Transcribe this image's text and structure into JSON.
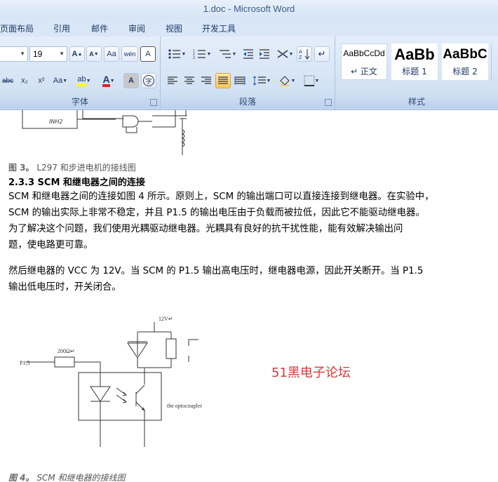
{
  "window": {
    "title": "1.doc - Microsoft Word"
  },
  "tabs": [
    "页面布局",
    "引用",
    "邮件",
    "审阅",
    "视图",
    "开发工具"
  ],
  "font_group": {
    "label": "字体",
    "font_size": "19",
    "buttons": {
      "grow": "A",
      "shrink": "A",
      "clear": "Aa",
      "phonetic": "wén",
      "border": "A",
      "strike": "abc",
      "subscript": "x₂",
      "superscript": "x²",
      "case": "Aa",
      "highlight": "ab",
      "color": "A",
      "shade": "A",
      "enclose": "字"
    }
  },
  "paragraph_group": {
    "label": "段落"
  },
  "styles_group": {
    "label": "样式",
    "styles": [
      {
        "sample": "AaBbCcDd",
        "name": "↵ 正文"
      },
      {
        "sample": "AaBb",
        "name": "标题 1"
      },
      {
        "sample": "AaBbC",
        "name": "标题 2"
      }
    ]
  },
  "document": {
    "fig3_label": "图 3。",
    "fig3_caption": "L297 和步进电机的接线图",
    "diagram3_label": "INH2",
    "heading": "2.3.3 SCM 和继电器之间的连接",
    "para1_lines": [
      "SCM 和继电器之间的连接如图 4 所示。原则上，SCM 的输出端口可以直接连接到继电器。在实验中，",
      "SCM 的输出实际上非常不稳定，并且 P1.5 的输出电压由于负载而被拉低，因此它不能驱动继电器。",
      "为了解决这个问题，我们使用光耦驱动继电器。光耦具有良好的抗干扰性能，能有效解决输出问",
      "题，使电路更可靠。"
    ],
    "para2_lines": [
      "然后继电器的 VCC 为 12V。当 SCM 的 P1.5 输出高电压时，继电器电源，因此开关断开。当 P1.5",
      "输出低电压时，开关闭合。"
    ],
    "diagram4": {
      "vcc_label": "12V↵",
      "resistor_label": "200Ω↵",
      "input_label": "P1.5",
      "optocoupler_label": "the optocoupler"
    },
    "watermark": "51黑电子论坛",
    "fig4_label": "图 4。",
    "fig4_caption": "SCM 和继电器的接线图"
  }
}
